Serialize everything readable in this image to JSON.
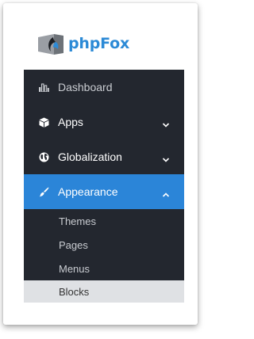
{
  "brand": {
    "name": "phpFox",
    "logo_icon": "phpfox-logo-icon",
    "color": "#2c8ad6"
  },
  "menu": {
    "items": [
      {
        "label": "Dashboard",
        "icon": "bar-chart-icon",
        "has_chevron": false,
        "active": false
      },
      {
        "label": "Apps",
        "icon": "cube-icon",
        "has_chevron": true,
        "chevron": "chevron-down-icon",
        "active": false
      },
      {
        "label": "Globalization",
        "icon": "globe-icon",
        "has_chevron": true,
        "chevron": "chevron-down-icon",
        "active": false
      },
      {
        "label": "Appearance",
        "icon": "paint-brush-icon",
        "has_chevron": true,
        "chevron": "chevron-up-icon",
        "active": true,
        "expanded": true
      }
    ],
    "subitems": [
      {
        "label": "Themes",
        "selected": false
      },
      {
        "label": "Pages",
        "selected": false
      },
      {
        "label": "Menus",
        "selected": false
      },
      {
        "label": "Blocks",
        "selected": true
      }
    ]
  },
  "colors": {
    "menu_background": "#23272f",
    "active_background": "#2b85d8",
    "selected_subitem_background": "#dfe1e4"
  }
}
